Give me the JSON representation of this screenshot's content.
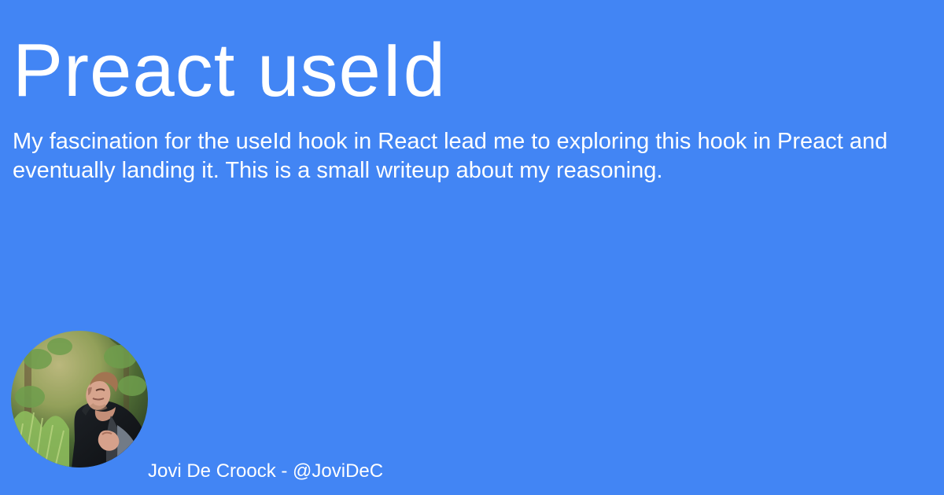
{
  "header": {
    "title": "Preact useId",
    "description": "My fascination for the useId hook in React lead me to exploring this hook in Preact and eventually landing it. This is a small writeup about my reasoning."
  },
  "author": {
    "byline": "Jovi De Croock - @JoviDeC",
    "avatar_icon": "author-photo"
  },
  "colors": {
    "background": "#4285f4",
    "text": "#ffffff"
  }
}
